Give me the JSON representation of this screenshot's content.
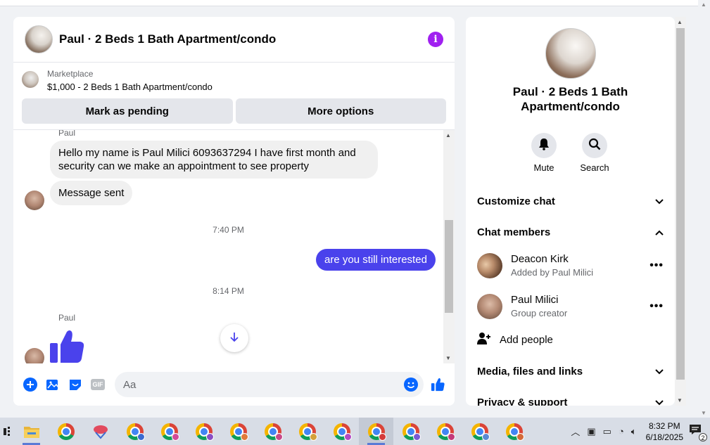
{
  "chat": {
    "title": "Paul · 2 Beds 1 Bath Apartment/condo",
    "marketplace_label": "Marketplace",
    "marketplace_item": "$1,000 - 2 Beds 1 Bath Apartment/condo",
    "mark_pending": "Mark as pending",
    "more_options": "More options"
  },
  "messages": {
    "sender_top": "Paul",
    "msg1": "Hello my name is Paul Milici 6093637294 I have first month and security can we make an appointment to see property",
    "msg2": "Message sent",
    "time1": "7:40 PM",
    "out1": "are you still interested",
    "time2": "8:14 PM",
    "sender_bottom": "Paul"
  },
  "composer": {
    "placeholder": "Aa",
    "gif": "GIF"
  },
  "side": {
    "title": "Paul · 2 Beds 1 Bath Apartment/condo",
    "mute": "Mute",
    "search": "Search",
    "customize": "Customize chat",
    "members_header": "Chat members",
    "members": [
      {
        "name": "Deacon Kirk",
        "sub": "Added by Paul Milici"
      },
      {
        "name": "Paul Milici",
        "sub": "Group creator"
      }
    ],
    "add_people": "Add people",
    "media": "Media, files and links",
    "privacy": "Privacy & support"
  },
  "taskbar": {
    "time": "8:32 PM",
    "date": "6/18/2025",
    "notifications": "2"
  },
  "colors": {
    "accent": "#4a42ec",
    "info": "#a020f0",
    "bubble_in": "#f0f0f0"
  }
}
